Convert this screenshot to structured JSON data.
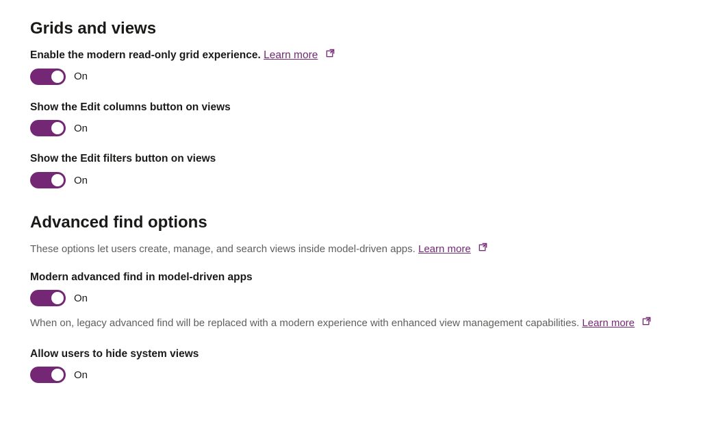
{
  "sections": {
    "grids": {
      "title": "Grids and views",
      "settings": {
        "modern_grid": {
          "label": "Enable the modern read-only grid experience.",
          "learn_more": "Learn more",
          "state": "On"
        },
        "edit_columns": {
          "label": "Show the Edit columns button on views",
          "state": "On"
        },
        "edit_filters": {
          "label": "Show the Edit filters button on views",
          "state": "On"
        }
      }
    },
    "advanced_find": {
      "title": "Advanced find options",
      "description": "These options let users create, manage, and search views inside model-driven apps.",
      "learn_more": "Learn more",
      "settings": {
        "modern_find": {
          "label": "Modern advanced find in model-driven apps",
          "state": "On",
          "help": "When on, legacy advanced find will be replaced with a modern experience with enhanced view management capabilities.",
          "help_learn_more": "Learn more"
        },
        "hide_system_views": {
          "label": "Allow users to hide system views",
          "state": "On"
        }
      }
    }
  }
}
